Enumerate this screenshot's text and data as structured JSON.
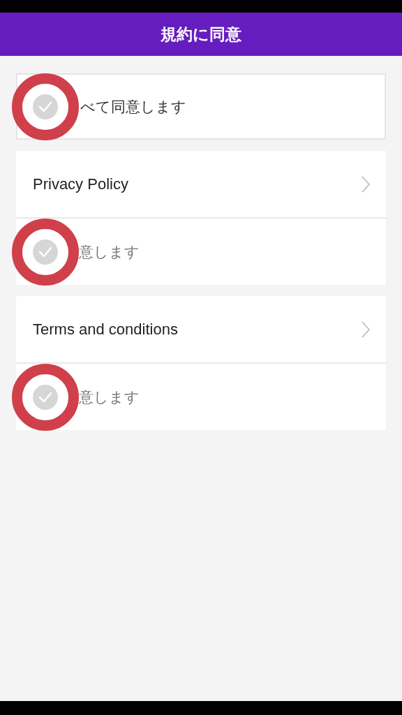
{
  "header": {
    "title": "規約に同意"
  },
  "agree_all": {
    "label": "べて同意します",
    "checked": false,
    "annotated": true
  },
  "sections": [
    {
      "title": "Privacy Policy",
      "agree": {
        "label": "意します",
        "checked": false,
        "annotated": true
      }
    },
    {
      "title": "Terms and conditions",
      "agree": {
        "label": "意します",
        "checked": false,
        "annotated": true
      }
    }
  ]
}
